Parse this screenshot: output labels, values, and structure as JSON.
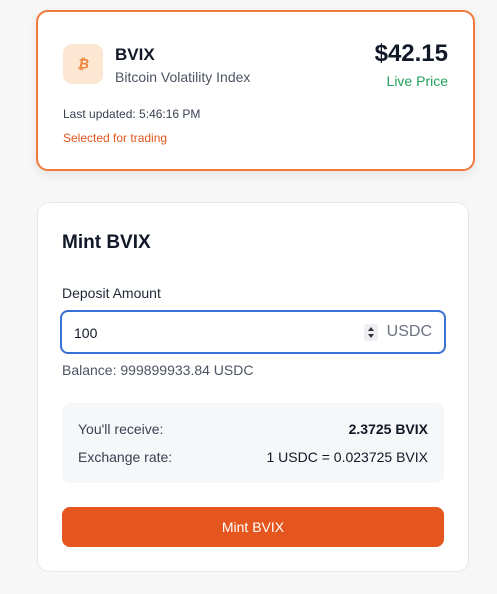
{
  "asset": {
    "symbol": "BVIX",
    "name": "Bitcoin Volatility Index",
    "price": "$42.15",
    "price_status": "Live Price",
    "last_updated": "Last updated: 5:46:16 PM",
    "selected_text": "Selected for trading",
    "icon": "bitcoin-icon"
  },
  "mint": {
    "title": "Mint BVIX",
    "deposit_label": "Deposit Amount",
    "amount_value": "100",
    "unit": "USDC",
    "balance": "Balance: 999899933.84 USDC",
    "summary": [
      {
        "label": "You'll receive:",
        "value": "2.3725 BVIX",
        "bold": true
      },
      {
        "label": "Exchange rate:",
        "value": "1 USDC = 0.023725 BVIX",
        "bold": false
      }
    ],
    "button_label": "Mint BVIX"
  },
  "colors": {
    "accent": "#e5561f",
    "selected_border": "#f07a3a",
    "live_green": "#22a05b",
    "focus_blue": "#3b6fd8"
  }
}
